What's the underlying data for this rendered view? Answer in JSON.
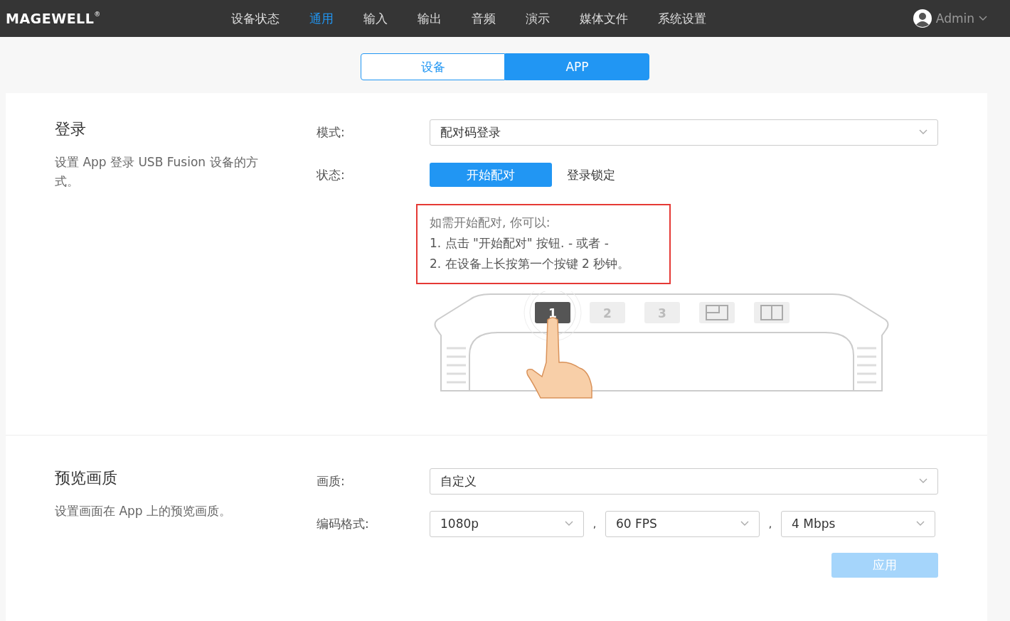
{
  "brand": {
    "logo": "MAGEWELL",
    "mark": "®"
  },
  "nav": [
    {
      "label": "设备状态",
      "selected": false
    },
    {
      "label": "通用",
      "selected": true
    },
    {
      "label": "输入",
      "selected": false
    },
    {
      "label": "输出",
      "selected": false
    },
    {
      "label": "音频",
      "selected": false
    },
    {
      "label": "演示",
      "selected": false
    },
    {
      "label": "媒体文件",
      "selected": false
    },
    {
      "label": "系统设置",
      "selected": false
    }
  ],
  "user": {
    "name": "Admin"
  },
  "tabs": [
    {
      "label": "设备",
      "selected": false
    },
    {
      "label": "APP",
      "selected": true
    }
  ],
  "login": {
    "title": "登录",
    "description": "设置 App 登录 USB Fusion 设备的方式。",
    "mode_label": "模式:",
    "mode_value": "配对码登录",
    "status_label": "状态:",
    "pair_button": "开始配对",
    "lock_label": "登录锁定",
    "hint": [
      "如需开始配对, 你可以:",
      "1. 点击 \"开始配对\" 按钮. - 或者 -",
      "2. 在设备上长按第一个按键 2 秒钟。"
    ],
    "device_keys": [
      {
        "kind": "number",
        "label": "1",
        "selected": true
      },
      {
        "kind": "number",
        "label": "2",
        "selected": false
      },
      {
        "kind": "number",
        "label": "3",
        "selected": false
      },
      {
        "kind": "pip",
        "selected": false
      },
      {
        "kind": "split",
        "selected": false
      }
    ]
  },
  "preview": {
    "title": "预览画质",
    "description": "设置画面在 App 上的预览画质。",
    "quality_label": "画质:",
    "quality_value": "自定义",
    "format_label": "编码格式:",
    "resolution": "1080p",
    "separators": [
      ",",
      ","
    ],
    "framerate": "60 FPS",
    "bitrate": "4 Mbps",
    "apply_button": "应用",
    "apply_disabled": true
  }
}
